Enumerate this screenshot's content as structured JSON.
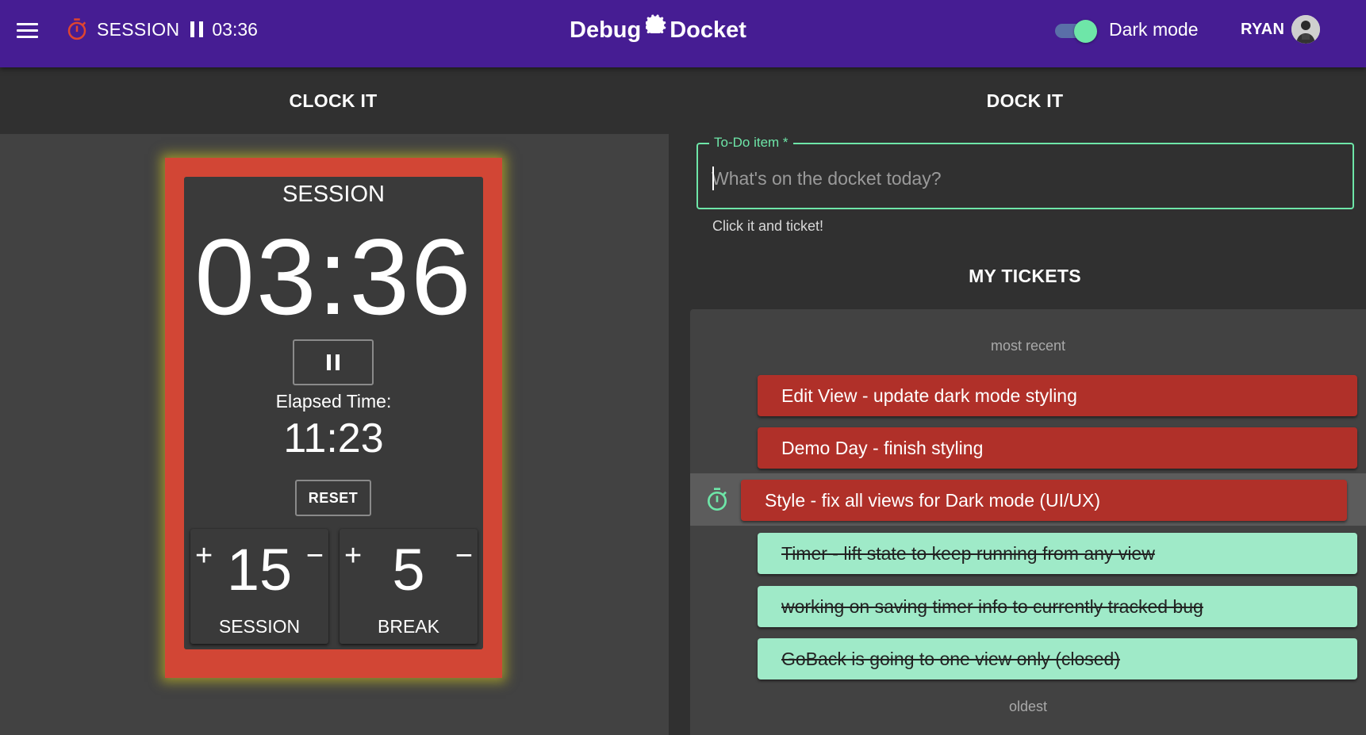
{
  "header": {
    "session_label": "SESSION",
    "session_time": "03:36",
    "logo_left": "Debug",
    "logo_right": "Docket",
    "dark_mode_label": "Dark mode",
    "dark_mode_on": true,
    "user_name": "RYAN",
    "colors": {
      "appbar": "#461d93",
      "accent": "#6ee6a8",
      "timer_icon": "#e0452f"
    }
  },
  "clock": {
    "section_title": "CLOCK IT",
    "mode": "SESSION",
    "time": "03:36",
    "elapsed_label": "Elapsed Time:",
    "elapsed": "11:23",
    "reset_label": "RESET",
    "session_length": {
      "value": "15",
      "label": "SESSION",
      "plus": "+",
      "minus": "−"
    },
    "break_length": {
      "value": "5",
      "label": "BREAK",
      "plus": "+",
      "minus": "−"
    },
    "colors": {
      "frame": "#d24635",
      "glow": "#dcd21e"
    }
  },
  "dock": {
    "section_title": "DOCK IT",
    "input_label": "To-Do item *",
    "input_placeholder": "What's on the docket today?",
    "input_value": "",
    "helper_text": "Click it and ticket!",
    "tickets_title": "MY TICKETS",
    "top_label": "most recent",
    "bottom_label": "oldest",
    "tickets": [
      {
        "text": "Edit View - update dark mode styling",
        "status": "open",
        "active": false
      },
      {
        "text": "Demo Day - finish styling",
        "status": "open",
        "active": false
      },
      {
        "text": "Style - fix all views for Dark mode (UI/UX)",
        "status": "open",
        "active": true
      },
      {
        "text": "Timer - lift state to keep running from any view",
        "status": "closed",
        "active": false
      },
      {
        "text": "working on saving timer info to currently tracked bug",
        "status": "closed",
        "active": false
      },
      {
        "text": "GoBack is going to one view only (closed)",
        "status": "closed",
        "active": false
      }
    ],
    "colors": {
      "open": "#b03029",
      "closed": "#9feac8"
    }
  }
}
